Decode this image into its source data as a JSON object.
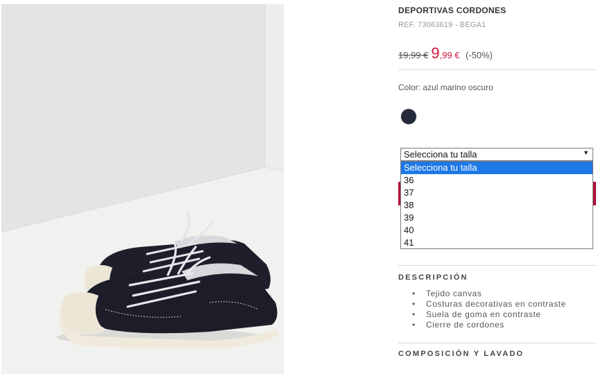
{
  "product": {
    "title": "DEPORTIVAS CORDONES",
    "reference": "REF. 73063619 - BEGA1",
    "old_price": "19,99 €",
    "new_price_int": "9",
    "new_price_dec": ",99 €",
    "discount": "(-50%)",
    "color_label": "Color:",
    "color_value": "azul marino oscuro",
    "swatch_color": "#252a3a",
    "accent_color": "#d4143a"
  },
  "size_select": {
    "current": "Selecciona tu talla",
    "options": [
      "Selecciona tu talla",
      "36",
      "37",
      "38",
      "39",
      "40",
      "41"
    ],
    "highlighted": "Selecciona tu talla"
  },
  "description": {
    "title": "DESCRIPCIÓN",
    "items": [
      "Tejido canvas",
      "Costuras decorativas en contraste",
      "Suela de goma en contraste",
      "Cierre de cordones"
    ]
  },
  "composition": {
    "title": "COMPOSICIÓN Y LAVADO"
  }
}
